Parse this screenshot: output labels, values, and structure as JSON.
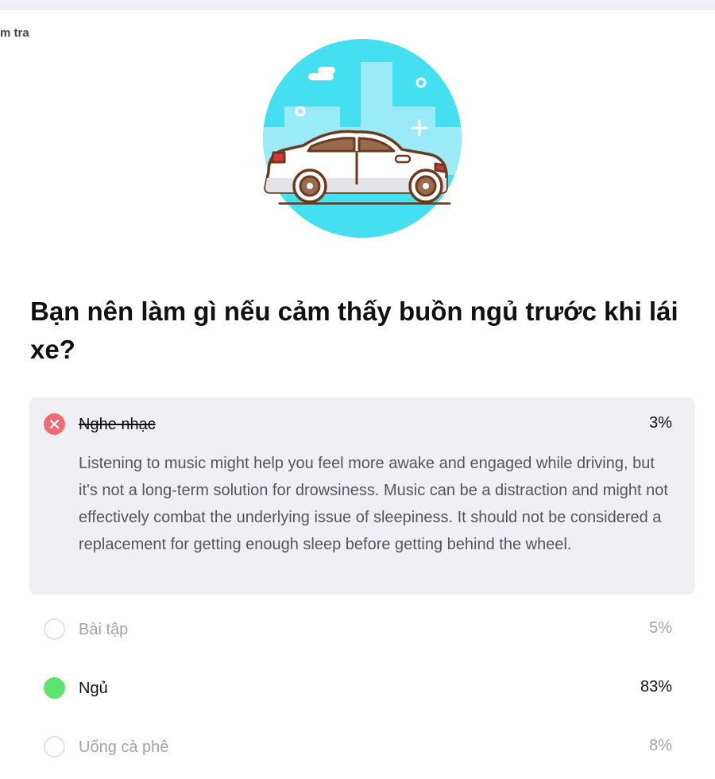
{
  "header": {
    "breadcrumb_fragment": "m tra"
  },
  "illustration": {
    "icon": "car-illustration",
    "colors": {
      "sky": "#45dff2",
      "building": "#9aeaf8",
      "outline": "#6b3a1f",
      "car_body": "#ffffff",
      "window": "#9a6a4f"
    }
  },
  "question": {
    "title": "Bạn nên làm gì nếu cảm thấy buồn ngủ trước khi lái xe?"
  },
  "selected_answer": {
    "label": "Nghe nhạc",
    "percent": "3%",
    "status": "wrong",
    "explanation": "Listening to music might help you feel more awake and engaged while driving, but it's not a long-term solution for drowsiness. Music can be a distraction and might not effectively combat the underlying issue of sleepiness. It should not be considered a replacement for getting enough sleep before getting behind the wheel."
  },
  "options": [
    {
      "label": "Bài tập",
      "percent": "5%",
      "status": "unselected"
    },
    {
      "label": "Ngủ",
      "percent": "83%",
      "status": "correct"
    },
    {
      "label": "Uống cà phê",
      "percent": "8%",
      "status": "unselected"
    }
  ],
  "colors": {
    "wrong": "#f06a78",
    "correct": "#5fe36a",
    "card_bg": "#f0f0f4"
  }
}
